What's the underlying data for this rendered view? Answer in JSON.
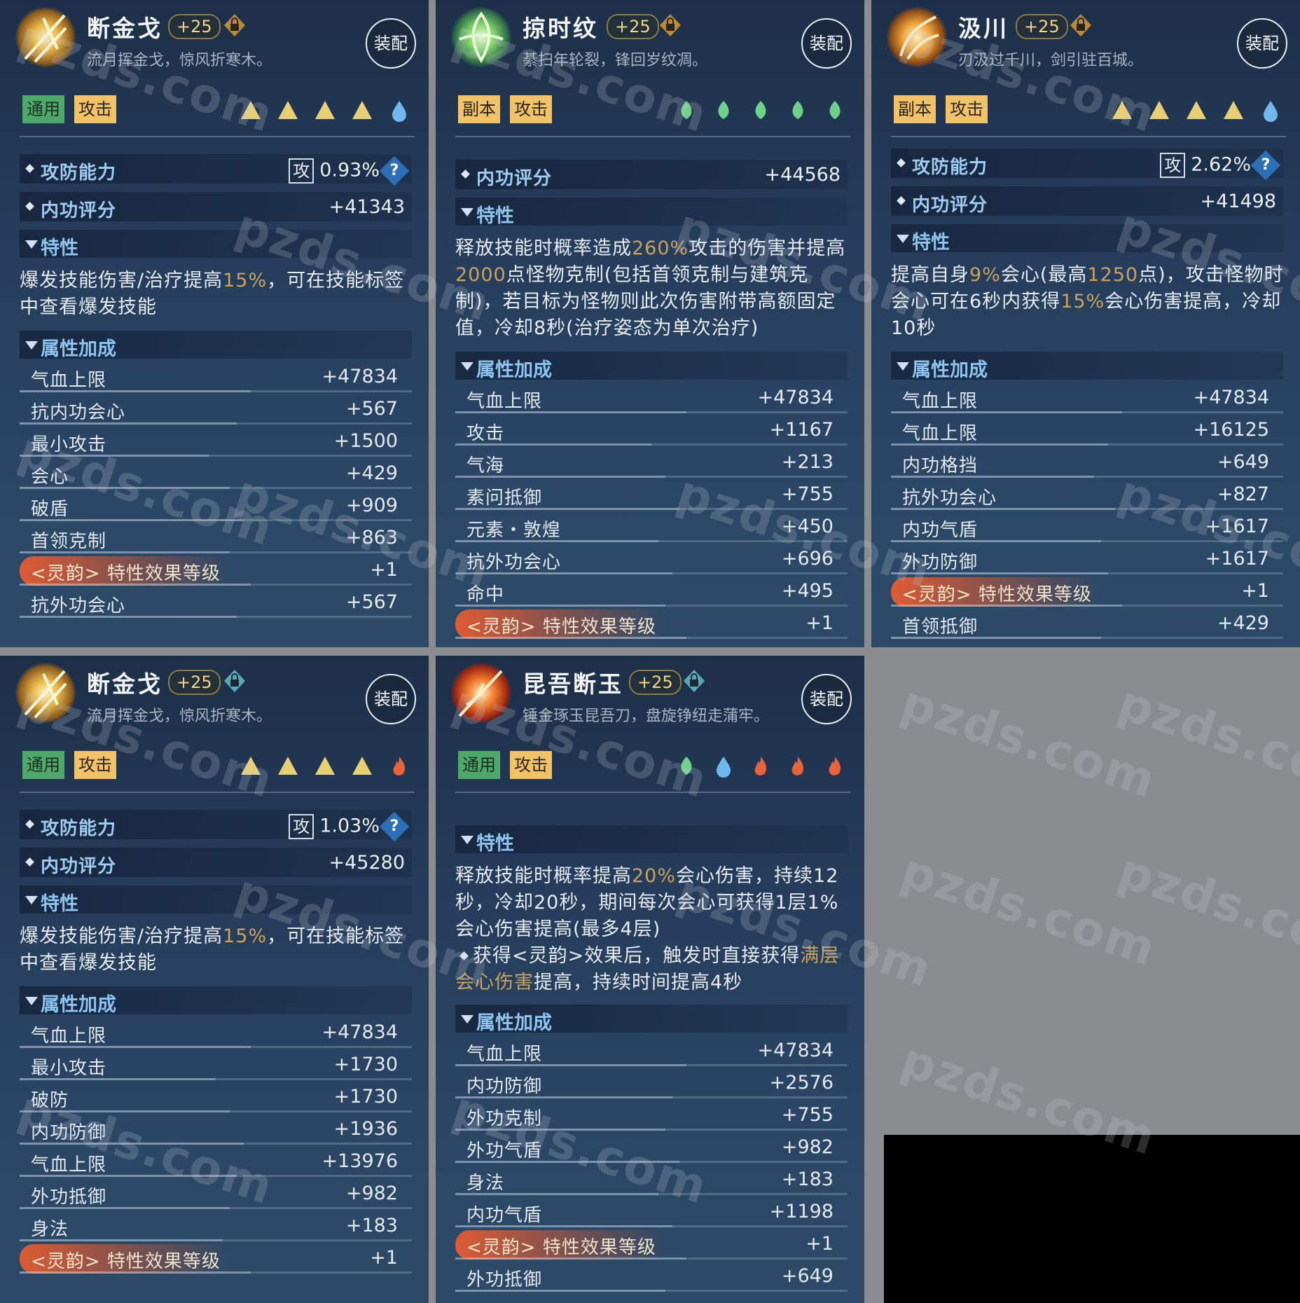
{
  "cards": [
    {
      "name": "断金戈",
      "level": "+25",
      "desc": "流月挥金戈，惊风折寒木。",
      "equip": "装配",
      "tags": [
        "通用",
        "攻击"
      ],
      "attack_label": "攻防能力",
      "attack_prefix": "攻",
      "attack_value": "0.93%",
      "help": "?",
      "score_label": "内功评分",
      "score_value": "+41343",
      "trait_title": "特性",
      "trait_parts": [
        "爆发技能伤害/治疗提高",
        "15%",
        "，可在技能标签中查看爆发技能"
      ],
      "attr_title": "属性加成",
      "stats": [
        {
          "label": "气血上限",
          "value": "+47834"
        },
        {
          "label": "抗内功会心",
          "value": "+567"
        },
        {
          "label": "最小攻击",
          "value": "+1500"
        },
        {
          "label": "会心",
          "value": "+429"
        },
        {
          "label": "破盾",
          "value": "+909"
        },
        {
          "label": "首领克制",
          "value": "+863"
        },
        {
          "label": "<灵韵>",
          "label2": "特性效果等级",
          "value": "+1",
          "special": true
        },
        {
          "label": "抗外功会心",
          "value": "+567"
        }
      ]
    },
    {
      "name": "掠时纹",
      "level": "+25",
      "desc": "綦扫年轮裂，锋回岁纹凋。",
      "equip": "装配",
      "tags": [
        "副本",
        "攻击"
      ],
      "score_label": "内功评分",
      "score_value": "+44568",
      "trait_title": "特性",
      "trait_parts": [
        "释放技能时概率造成",
        "260%",
        "攻击的伤害并提高",
        "2000",
        "点怪物克制(包括首领克制与建筑克制)，若目标为怪物则此次伤害附带高额固定值，冷却8秒(治疗姿态为单次治疗)"
      ],
      "attr_title": "属性加成",
      "stats": [
        {
          "label": "气血上限",
          "value": "+47834"
        },
        {
          "label": "攻击",
          "value": "+1167"
        },
        {
          "label": "气海",
          "value": "+213"
        },
        {
          "label": "素问抵御",
          "value": "+755"
        },
        {
          "label": "元素・敦煌",
          "value": "+450"
        },
        {
          "label": "抗外功会心",
          "value": "+696"
        },
        {
          "label": "命中",
          "value": "+495"
        },
        {
          "label": "<灵韵>",
          "label2": "特性效果等级",
          "value": "+1",
          "special": true
        }
      ]
    },
    {
      "name": "汲川",
      "level": "+25",
      "desc": "刃汲过千川，剑引驻百城。",
      "equip": "装配",
      "tags": [
        "副本",
        "攻击"
      ],
      "attack_label": "攻防能力",
      "attack_prefix": "攻",
      "attack_value": "2.62%",
      "help": "?",
      "score_label": "内功评分",
      "score_value": "+41498",
      "trait_title": "特性",
      "trait_parts": [
        "提高自身",
        "9%",
        "会心(最高",
        "1250",
        "点)，攻击怪物时会心可在6秒内获得",
        "15%",
        "会心伤害提高，冷却10秒"
      ],
      "attr_title": "属性加成",
      "stats": [
        {
          "label": "气血上限",
          "value": "+47834"
        },
        {
          "label": "气血上限",
          "value": "+16125"
        },
        {
          "label": "内功格挡",
          "value": "+649"
        },
        {
          "label": "抗外功会心",
          "value": "+827"
        },
        {
          "label": "内功气盾",
          "value": "+1617"
        },
        {
          "label": "外功防御",
          "value": "+1617"
        },
        {
          "label": "<灵韵>",
          "label2": "特性效果等级",
          "value": "+1",
          "special": true
        },
        {
          "label": "首领抵御",
          "value": "+429"
        }
      ]
    },
    {
      "name": "断金戈",
      "level": "+25",
      "desc": "流月挥金戈，惊风折寒木。",
      "equip": "装配",
      "tags": [
        "通用",
        "攻击"
      ],
      "attack_label": "攻防能力",
      "attack_prefix": "攻",
      "attack_value": "1.03%",
      "help": "?",
      "score_label": "内功评分",
      "score_value": "+45280",
      "trait_title": "特性",
      "trait_parts": [
        "爆发技能伤害/治疗提高",
        "15%",
        "，可在技能标签中查看爆发技能"
      ],
      "attr_title": "属性加成",
      "stats": [
        {
          "label": "气血上限",
          "value": "+47834"
        },
        {
          "label": "最小攻击",
          "value": "+1730"
        },
        {
          "label": "破防",
          "value": "+1730"
        },
        {
          "label": "内功防御",
          "value": "+1936"
        },
        {
          "label": "气血上限",
          "value": "+13976"
        },
        {
          "label": "外功抵御",
          "value": "+982"
        },
        {
          "label": "身法",
          "value": "+183"
        },
        {
          "label": "<灵韵>",
          "label2": "特性效果等级",
          "value": "+1",
          "special": true
        }
      ]
    },
    {
      "name": "昆吾断玉",
      "level": "+25",
      "desc": "锤金琢玉昆吾刀，盘旋铮纽走蒲牢。",
      "equip": "装配",
      "tags": [
        "通用",
        "攻击"
      ],
      "trait_title": "特性",
      "trait_parts": [
        "释放技能时概率提高",
        "20%",
        "会心伤害，持续12秒，冷却20秒，期间每次会心可获得1层1%会心伤害提高(最多4层)"
      ],
      "bullet_parts": [
        "获得<灵韵>效果后，触发时直接获得",
        "满层会心伤害",
        "提高，持续时间提高4秒"
      ],
      "attr_title": "属性加成",
      "stats": [
        {
          "label": "气血上限",
          "value": "+47834"
        },
        {
          "label": "内功防御",
          "value": "+2576"
        },
        {
          "label": "外功克制",
          "value": "+755"
        },
        {
          "label": "外功气盾",
          "value": "+982"
        },
        {
          "label": "身法",
          "value": "+183"
        },
        {
          "label": "内功气盾",
          "value": "+1198"
        },
        {
          "label": "<灵韵>",
          "label2": "特性效果等级",
          "value": "+1",
          "special": true
        },
        {
          "label": "外功抵御",
          "value": "+649"
        }
      ]
    }
  ],
  "watermark": "pzds.com",
  "colors": {
    "highlight": "#c9a35c",
    "section": "#8cc3ef",
    "special": "#e85c30"
  }
}
